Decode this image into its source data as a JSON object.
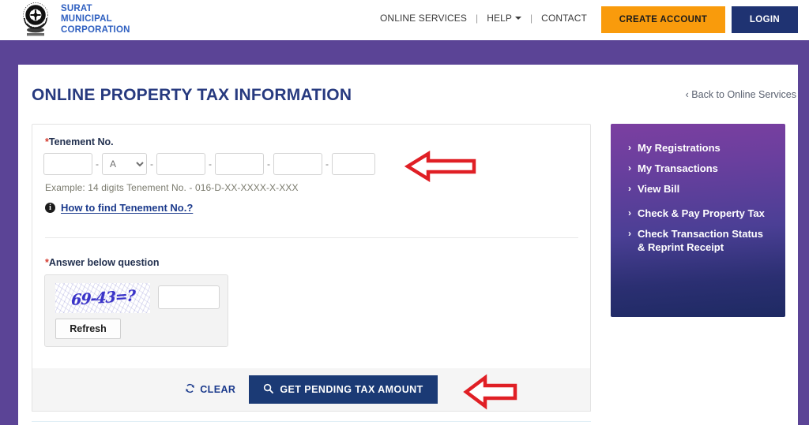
{
  "header": {
    "brand": {
      "line1": "SURAT",
      "line2": "MUNICIPAL",
      "line3": "CORPORATION",
      "emblem_icon": "surat-municipal-corporation-emblem"
    },
    "nav": [
      {
        "label": "ONLINE SERVICES",
        "has_caret": false
      },
      {
        "label": "HELP",
        "has_caret": true
      },
      {
        "label": "CONTACT",
        "has_caret": false
      }
    ],
    "separator": "|",
    "create_account_label": "CREATE ACCOUNT",
    "login_label": "LOGIN",
    "colors": {
      "create_account_bg": "#f99b0c",
      "login_bg": "#1f3372",
      "brand_text": "#2e5fc0",
      "band": "#5b4496"
    }
  },
  "page": {
    "title": "ONLINE PROPERTY TAX INFORMATION",
    "back_link": "‹ Back to Online Services"
  },
  "form": {
    "tenement_label": "Tenement No.",
    "required_star": "*",
    "fields": [
      {
        "type": "text",
        "value": "",
        "name": "tenement-part-1"
      },
      {
        "type": "select",
        "value": "A",
        "name": "tenement-part-2"
      },
      {
        "type": "text",
        "value": "",
        "name": "tenement-part-3"
      },
      {
        "type": "text",
        "value": "",
        "name": "tenement-part-4"
      },
      {
        "type": "text",
        "value": "",
        "name": "tenement-part-5"
      },
      {
        "type": "text",
        "value": "",
        "name": "tenement-part-6"
      }
    ],
    "separator": "-",
    "example_text": "Example: 14 digits Tenement No. - 016-D-XX-XXXX-X-XXX",
    "how_to_link": "How to find Tenement No.?",
    "info_icon": "info-icon"
  },
  "captcha": {
    "label": "Answer below question",
    "question": "69-43=?",
    "answer_value": "",
    "refresh_label": "Refresh"
  },
  "actions": {
    "clear_label": "CLEAR",
    "clear_icon": "refresh-cycle-icon",
    "get_label": "GET PENDING TAX AMOUNT",
    "get_icon": "search-icon",
    "get_button_bg": "#1b3a75"
  },
  "sidebar": {
    "chevron": "›",
    "items": [
      {
        "label": "My Registrations",
        "spaced": false
      },
      {
        "label": "My Transactions",
        "spaced": false
      },
      {
        "label": "View Bill",
        "spaced": false
      },
      {
        "label": "Check & Pay Property Tax",
        "spaced": true
      },
      {
        "label": "Check Transaction Status & Reprint Receipt",
        "spaced": false
      }
    ],
    "gradient_from": "#7b3fa0",
    "gradient_to": "#1e2a63"
  },
  "annotations": [
    {
      "name": "arrow-pointing-to-tenement-fields",
      "color": "#e01f25",
      "direction": "left"
    },
    {
      "name": "arrow-pointing-to-get-pending-tax-button",
      "color": "#e01f25",
      "direction": "left"
    }
  ]
}
